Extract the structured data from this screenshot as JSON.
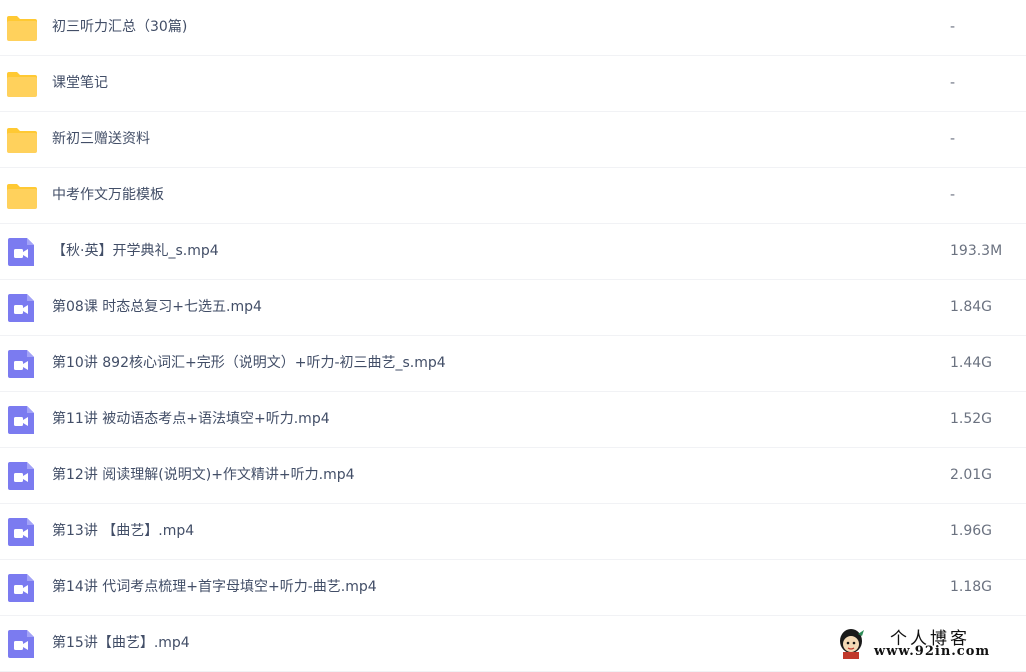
{
  "files": [
    {
      "type": "folder",
      "icon": "folder-icon",
      "name": "初三听力汇总（30篇)",
      "size": "-"
    },
    {
      "type": "folder",
      "icon": "folder-icon",
      "name": "课堂笔记",
      "size": "-"
    },
    {
      "type": "folder",
      "icon": "folder-icon",
      "name": "新初三赠送资料",
      "size": "-"
    },
    {
      "type": "folder",
      "icon": "folder-icon",
      "name": "中考作文万能模板",
      "size": "-"
    },
    {
      "type": "video",
      "icon": "video-file-icon",
      "name": "【秋·英】开学典礼_s.mp4",
      "size": "193.3M"
    },
    {
      "type": "video",
      "icon": "video-file-icon",
      "name": "第08课 时态总复习+七选五.mp4",
      "size": "1.84G"
    },
    {
      "type": "video",
      "icon": "video-file-icon",
      "name": "第10讲 892核心词汇+完形（说明文）+听力-初三曲艺_s.mp4",
      "size": "1.44G"
    },
    {
      "type": "video",
      "icon": "video-file-icon",
      "name": "第11讲 被动语态考点+语法填空+听力.mp4",
      "size": "1.52G"
    },
    {
      "type": "video",
      "icon": "video-file-icon",
      "name": "第12讲 阅读理解(说明文)+作文精讲+听力.mp4",
      "size": "2.01G"
    },
    {
      "type": "video",
      "icon": "video-file-icon",
      "name": "第13讲 【曲艺】.mp4",
      "size": "1.96G"
    },
    {
      "type": "video",
      "icon": "video-file-icon",
      "name": "第14讲 代词考点梳理+首字母填空+听力-曲艺.mp4",
      "size": "1.18G"
    },
    {
      "type": "video",
      "icon": "video-file-icon",
      "name": "第15讲【曲艺】.mp4",
      "size": ""
    }
  ],
  "watermark": {
    "line1": "个人博客",
    "line2": "www.92in.com"
  },
  "colors": {
    "folder": "#ffd15c",
    "folder_tab": "#ffc933",
    "video": "#7b7bf0",
    "text": "#424e67",
    "divider": "#f1f2f5"
  }
}
